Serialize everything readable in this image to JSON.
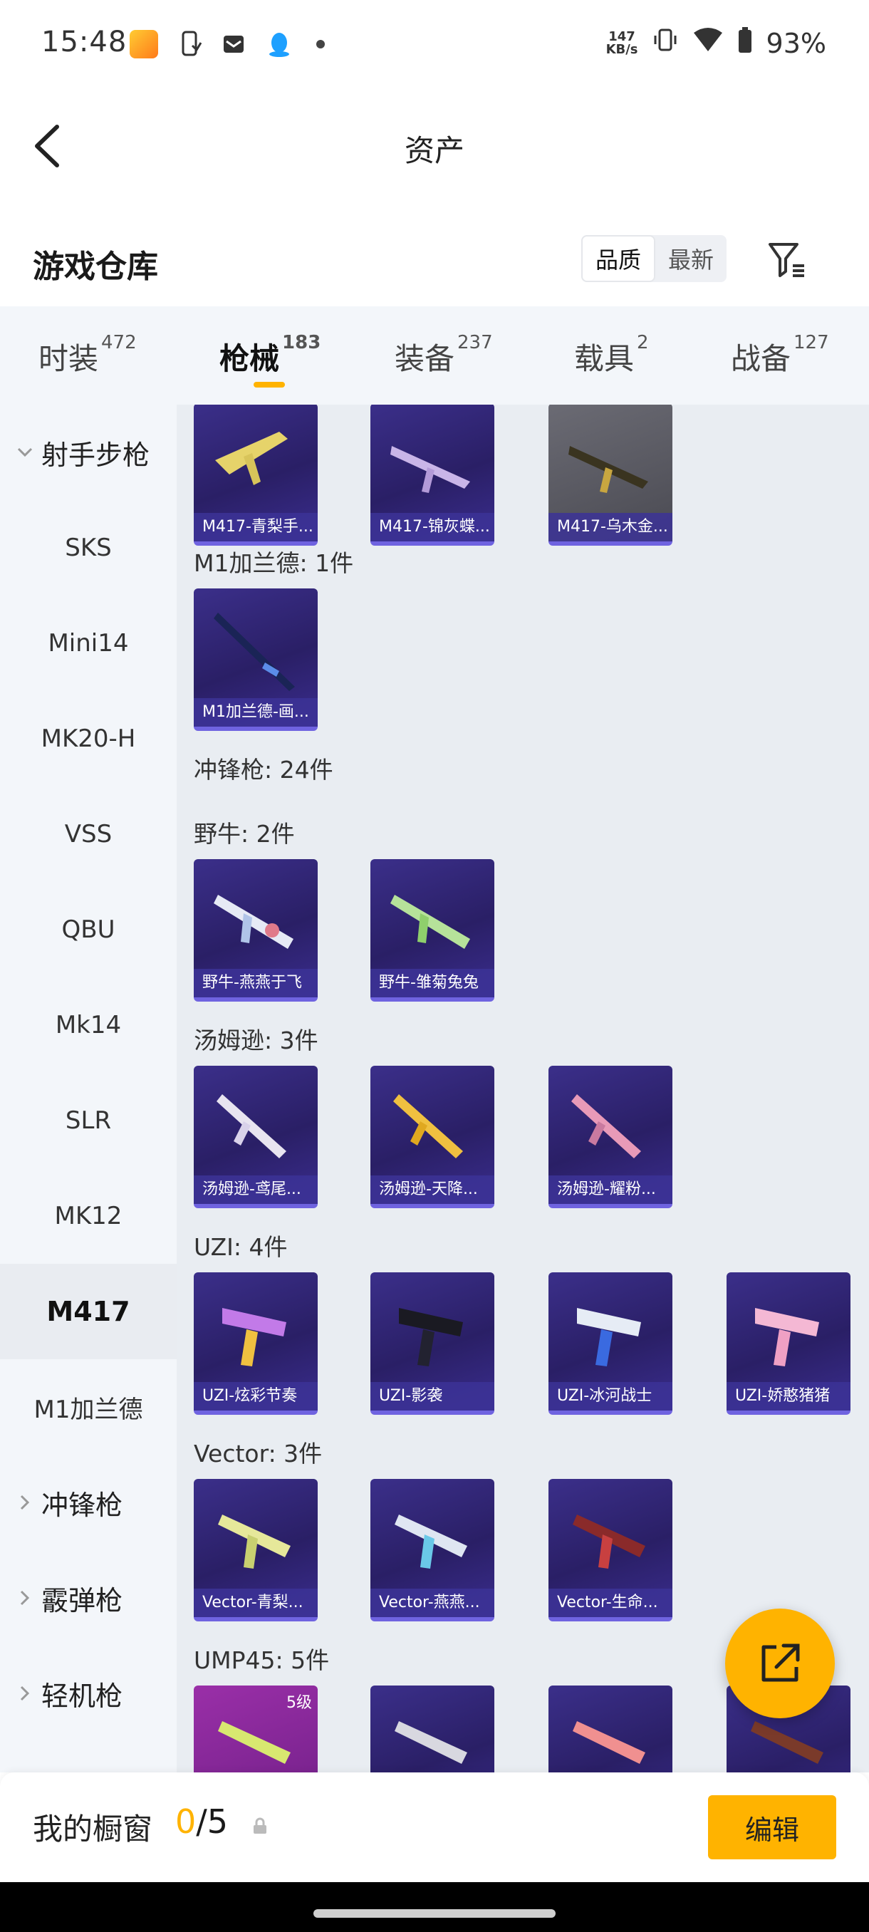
{
  "status_bar": {
    "time": "15:48",
    "net_speed_value": "147",
    "net_speed_unit": "KB/s",
    "battery": "93%"
  },
  "nav": {
    "title": "资产"
  },
  "header": {
    "title": "游戏仓库",
    "sort_quality": "品质",
    "sort_latest": "最新"
  },
  "tabs": [
    {
      "label": "时装",
      "count": "472"
    },
    {
      "label": "枪械",
      "count": "183"
    },
    {
      "label": "装备",
      "count": "237"
    },
    {
      "label": "载具",
      "count": "2"
    },
    {
      "label": "战备",
      "count": "127"
    }
  ],
  "sidebar": [
    {
      "label": "射手步枪",
      "type": "group-open"
    },
    {
      "label": "SKS"
    },
    {
      "label": "Mini14"
    },
    {
      "label": "MK20-H"
    },
    {
      "label": "VSS"
    },
    {
      "label": "QBU"
    },
    {
      "label": "Mk14"
    },
    {
      "label": "SLR"
    },
    {
      "label": "MK12"
    },
    {
      "label": "M417",
      "active": true
    },
    {
      "label": "M1加兰德"
    },
    {
      "label": "冲锋枪",
      "type": "group-closed"
    },
    {
      "label": "霰弹枪",
      "type": "group-closed"
    },
    {
      "label": "轻机枪",
      "type": "group-closed"
    }
  ],
  "content": {
    "m417_items": [
      "M417-青梨手...",
      "M417-锦灰蝶...",
      "M417-乌木金..."
    ],
    "m1_header": "M1加兰德: 1件",
    "m1_items": [
      "M1加兰德-画..."
    ],
    "smg_header": "冲锋枪: 24件",
    "bison_header": "野牛: 2件",
    "bison_items": [
      "野牛-燕燕于飞",
      "野牛-雏菊兔兔"
    ],
    "thompson_header": "汤姆逊: 3件",
    "thompson_items": [
      "汤姆逊-鸢尾...",
      "汤姆逊-天降...",
      "汤姆逊-耀粉..."
    ],
    "uzi_header": "UZI: 4件",
    "uzi_items": [
      "UZI-炫彩节奏",
      "UZI-影袭",
      "UZI-冰河战士",
      "UZI-娇憨猪猪"
    ],
    "vector_header": "Vector: 3件",
    "vector_items": [
      "Vector-青梨...",
      "Vector-燕燕...",
      "Vector-生命..."
    ],
    "ump_header": "UMP45: 5件",
    "ump_badge": "5级"
  },
  "bottom": {
    "label": "我的橱窗",
    "current": "0",
    "total": "/5",
    "edit": "编辑"
  },
  "colors": {
    "accent": "#ffb300",
    "card_bg": "#2a1f66",
    "card_border": "#6f63e0"
  }
}
